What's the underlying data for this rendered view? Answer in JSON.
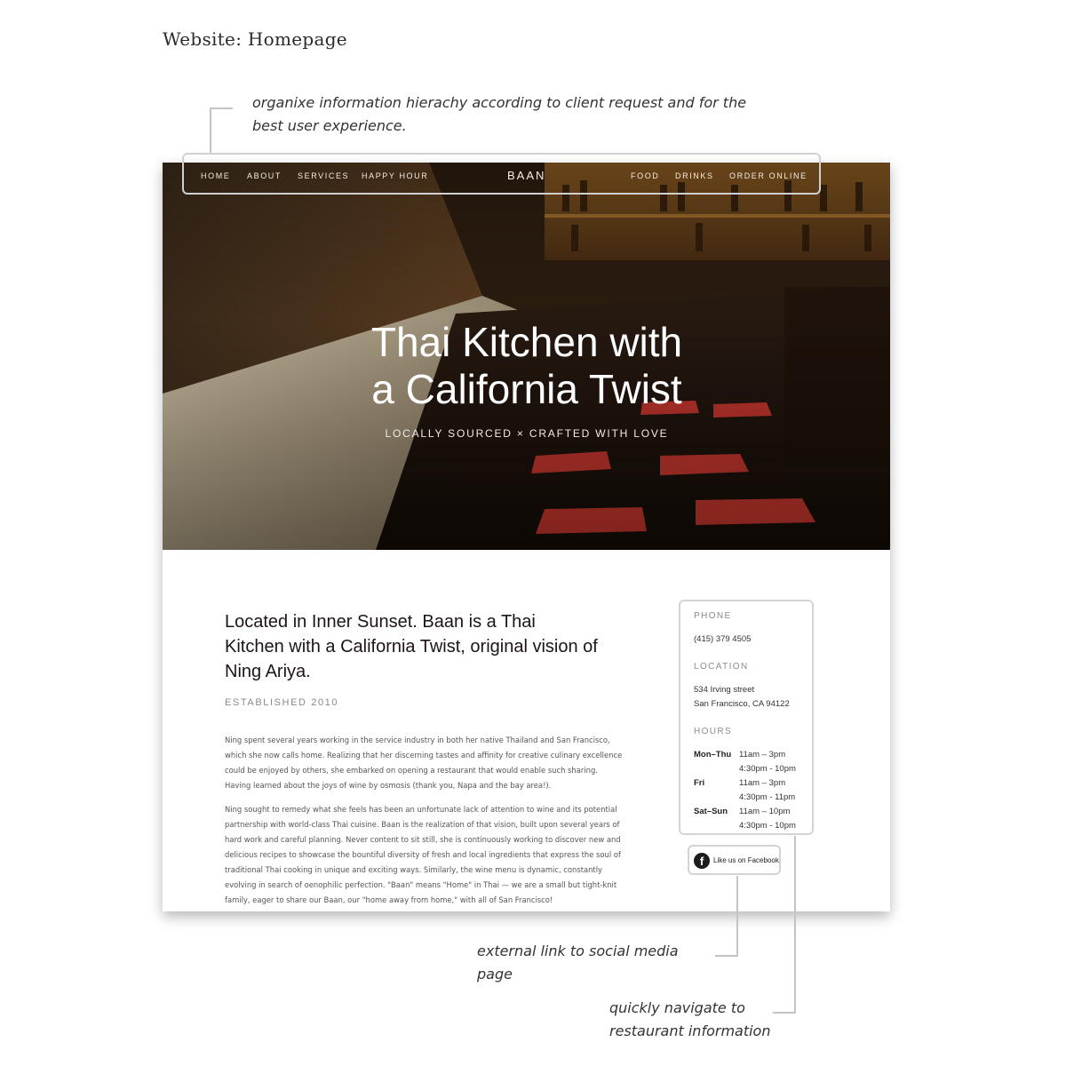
{
  "sheet": {
    "title": "Website: Homepage"
  },
  "annotations": {
    "top_note": "organixe information hierachy according to client request and for the best user experience.",
    "social_note": "external link to social media page",
    "info_note": "quickly navigate to restaurant information"
  },
  "nav": {
    "left": [
      "HOME",
      "ABOUT",
      "SERVICES",
      "HAPPY HOUR"
    ],
    "brand": "BAAN",
    "right": [
      "FOOD",
      "DRINKS",
      "ORDER ONLINE"
    ]
  },
  "hero": {
    "title_line1": "Thai Kitchen with",
    "title_line2": "a California Twist",
    "subtitle": "LOCALLY SOURCED × CRAFTED WITH LOVE"
  },
  "intro": {
    "lede": "Located in Inner Sunset. Baan is a Thai Kitchen with a California Twist, original vision of Ning Ariya.",
    "established": "ESTABLISHED 2010",
    "paragraph1": "Ning spent several years working in the service industry in both her native Thailand and San Francisco, which she now calls home. Realizing that her discerning tastes and affinity for creative culinary excellence could be enjoyed by others, she embarked on opening a restaurant that would enable such sharing. Having learned about the joys of wine by osmosis (thank you, Napa and the bay area!).",
    "paragraph2": "Ning sought to remedy what she feels has been an unfortunate lack of attention to wine and its potential partnership with world-class Thai cuisine. Baan is the realization of that vision, built upon several years of hard work and careful planning. Never content to sit still, she is continuously working to discover new and delicious recipes to showcase the bountiful diversity of fresh and local ingredients that express the soul of traditional Thai cooking in unique and exciting ways. Similarly, the wine menu is dynamic, constantly evolving in search of oenophilic perfection. \"Baan\" means \"Home\" in Thai — we are a small but tight-knit family, eager to share our Baan, our \"home away from home,\" with all of San Francisco!"
  },
  "info": {
    "phone_heading": "PHONE",
    "phone": "(415) 379 4505",
    "location_heading": "LOCATION",
    "address_line1": "534 Irving street",
    "address_line2": "San Francisco, CA 94122",
    "hours_heading": "HOURS",
    "hours": [
      {
        "day": "Mon–Thu",
        "lunch": "11am – 3pm",
        "dinner": "4:30pm - 10pm"
      },
      {
        "day": "Fri",
        "lunch": "11am – 3pm",
        "dinner": "4:30pm - 11pm"
      },
      {
        "day": "Sat–Sun",
        "lunch": "11am – 10pm",
        "dinner": "4:30pm - 10pm"
      }
    ]
  },
  "social": {
    "icon": "facebook-icon",
    "label": "Like us on Facebook"
  },
  "colors": {
    "annotation_line": "#c4c4c4",
    "hero_overlay": "#2c1c10",
    "text_dark": "#1e1416"
  }
}
